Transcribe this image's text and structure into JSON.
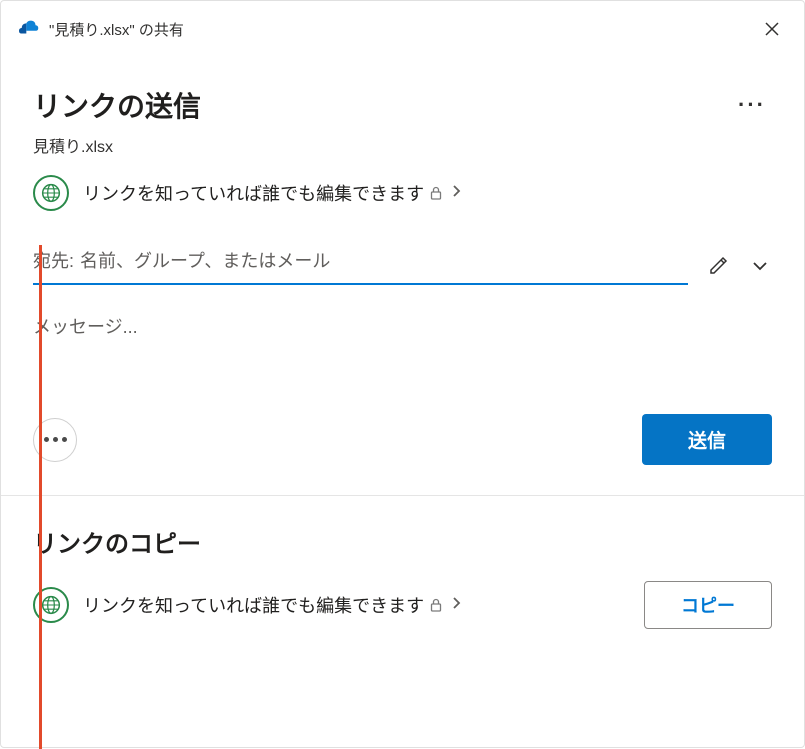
{
  "titlebar": {
    "title": "\"見積り.xlsx\" の共有"
  },
  "header": {
    "heading": "リンクの送信",
    "filename": "見積り.xlsx"
  },
  "permission": {
    "text": "リンクを知っていれば誰でも編集できます"
  },
  "recipient": {
    "label": "宛先:",
    "placeholder": "名前、グループ、またはメール"
  },
  "message": {
    "placeholder": "メッセージ..."
  },
  "actions": {
    "send": "送信"
  },
  "copy_section": {
    "heading": "リンクのコピー",
    "permission_text": "リンクを知っていれば誰でも編集できます",
    "copy_button": "コピー"
  }
}
